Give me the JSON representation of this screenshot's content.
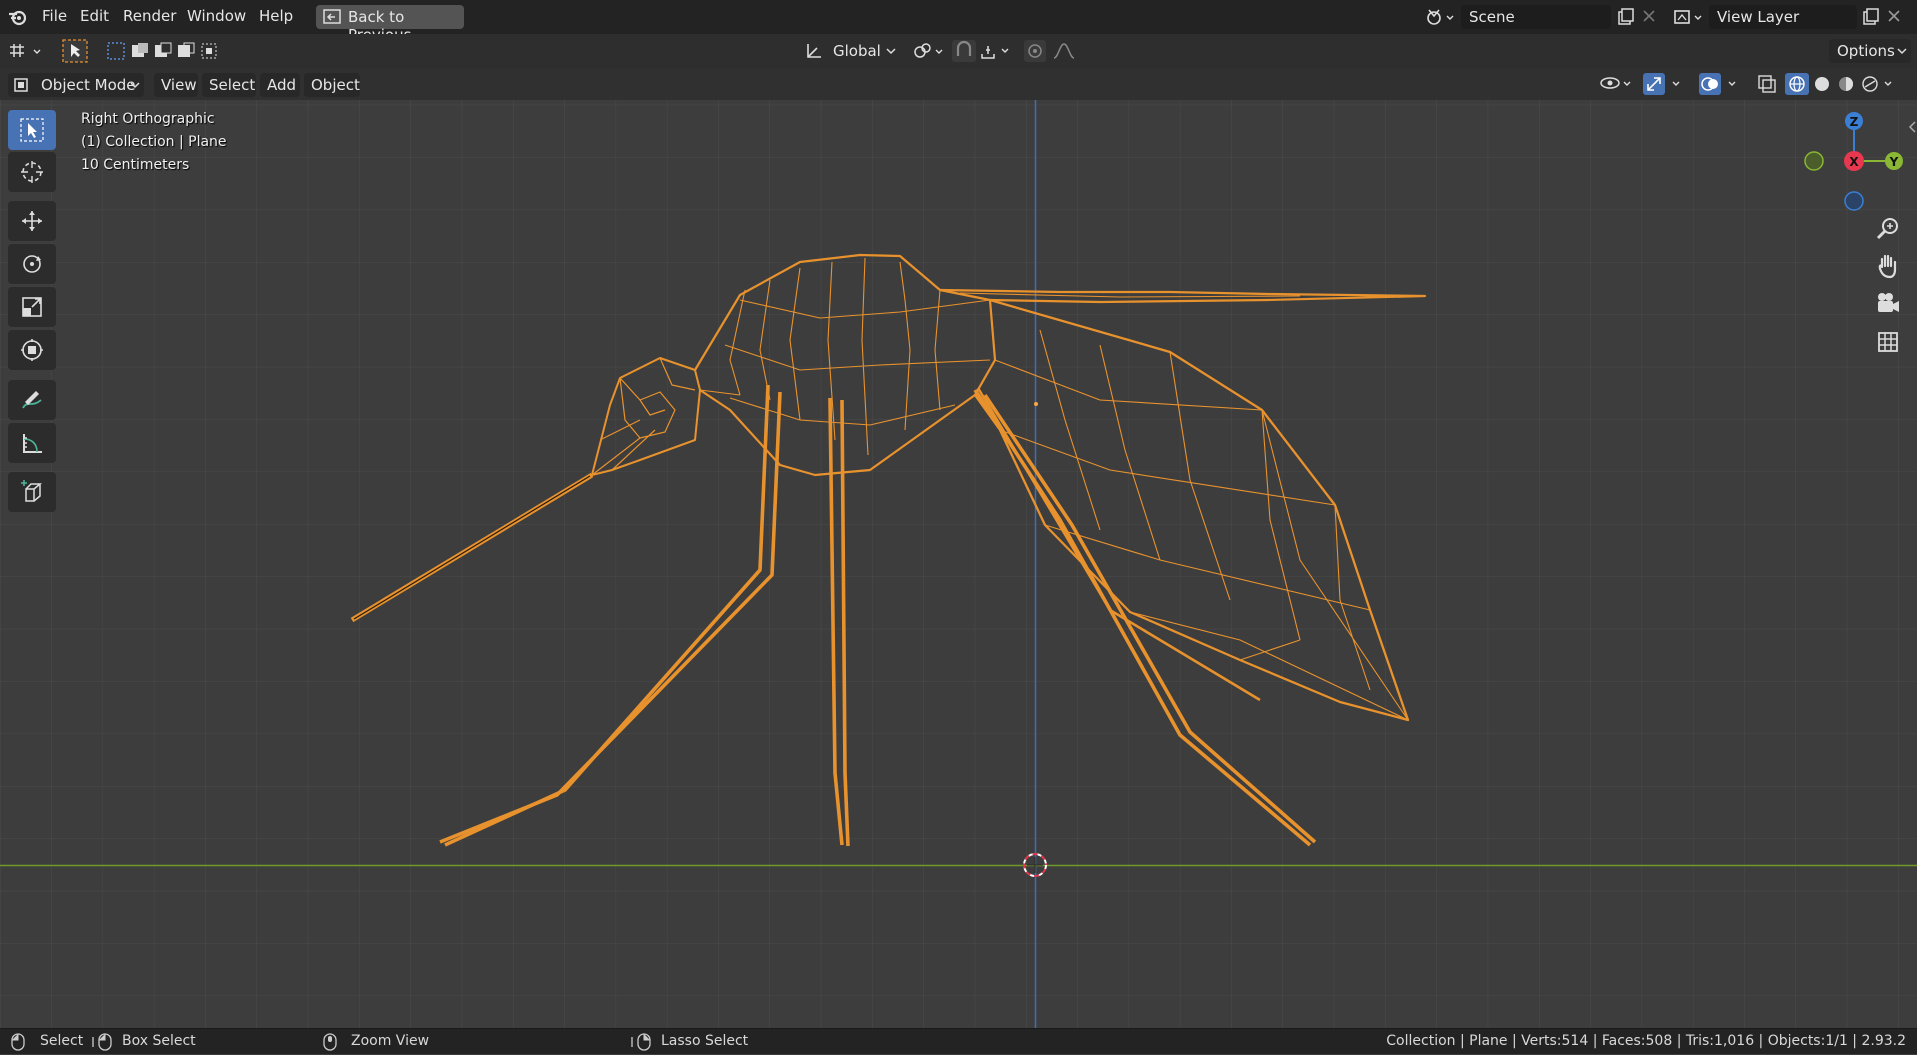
{
  "menu": {
    "items": [
      "File",
      "Edit",
      "Render",
      "Window",
      "Help"
    ],
    "back_button": "Back to Previous",
    "scene_label": "Scene",
    "view_layer_label": "View Layer"
  },
  "toolbar": {
    "transform_orientation": "Global",
    "options_label": "Options"
  },
  "header": {
    "mode": "Object Mode",
    "menus": [
      "View",
      "Select",
      "Add",
      "Object"
    ]
  },
  "overlay": {
    "view_name": "Right Orthographic",
    "collection": "(1) Collection | Plane",
    "scale": "10 Centimeters"
  },
  "gizmo": {
    "z": "Z",
    "x": "X",
    "y": "Y"
  },
  "status": {
    "select": "Select",
    "box_select": "Box Select",
    "zoom_view": "Zoom View",
    "lasso_select": "Lasso Select",
    "stats": "Collection | Plane | Verts:514 | Faces:508 | Tris:1,016 | Objects:1/1 | 2.93.2"
  },
  "colors": {
    "background": "#3d3d3d",
    "wire": "#e8922e",
    "active_tool": "#4772b3",
    "axis_x": "#e8384f",
    "axis_y": "#8ab734",
    "axis_z": "#3b7fd4"
  },
  "icons": [
    "blender-logo-icon",
    "back-icon",
    "scene-icon",
    "view-layer-icon",
    "select-tool-icon",
    "cursor-tool-icon",
    "move-tool-icon",
    "rotate-tool-icon",
    "scale-tool-icon",
    "transform-tool-icon",
    "annotate-tool-icon",
    "measure-tool-icon",
    "add-cube-tool-icon",
    "zoom-icon",
    "hand-icon",
    "camera-icon",
    "grid-icon"
  ]
}
